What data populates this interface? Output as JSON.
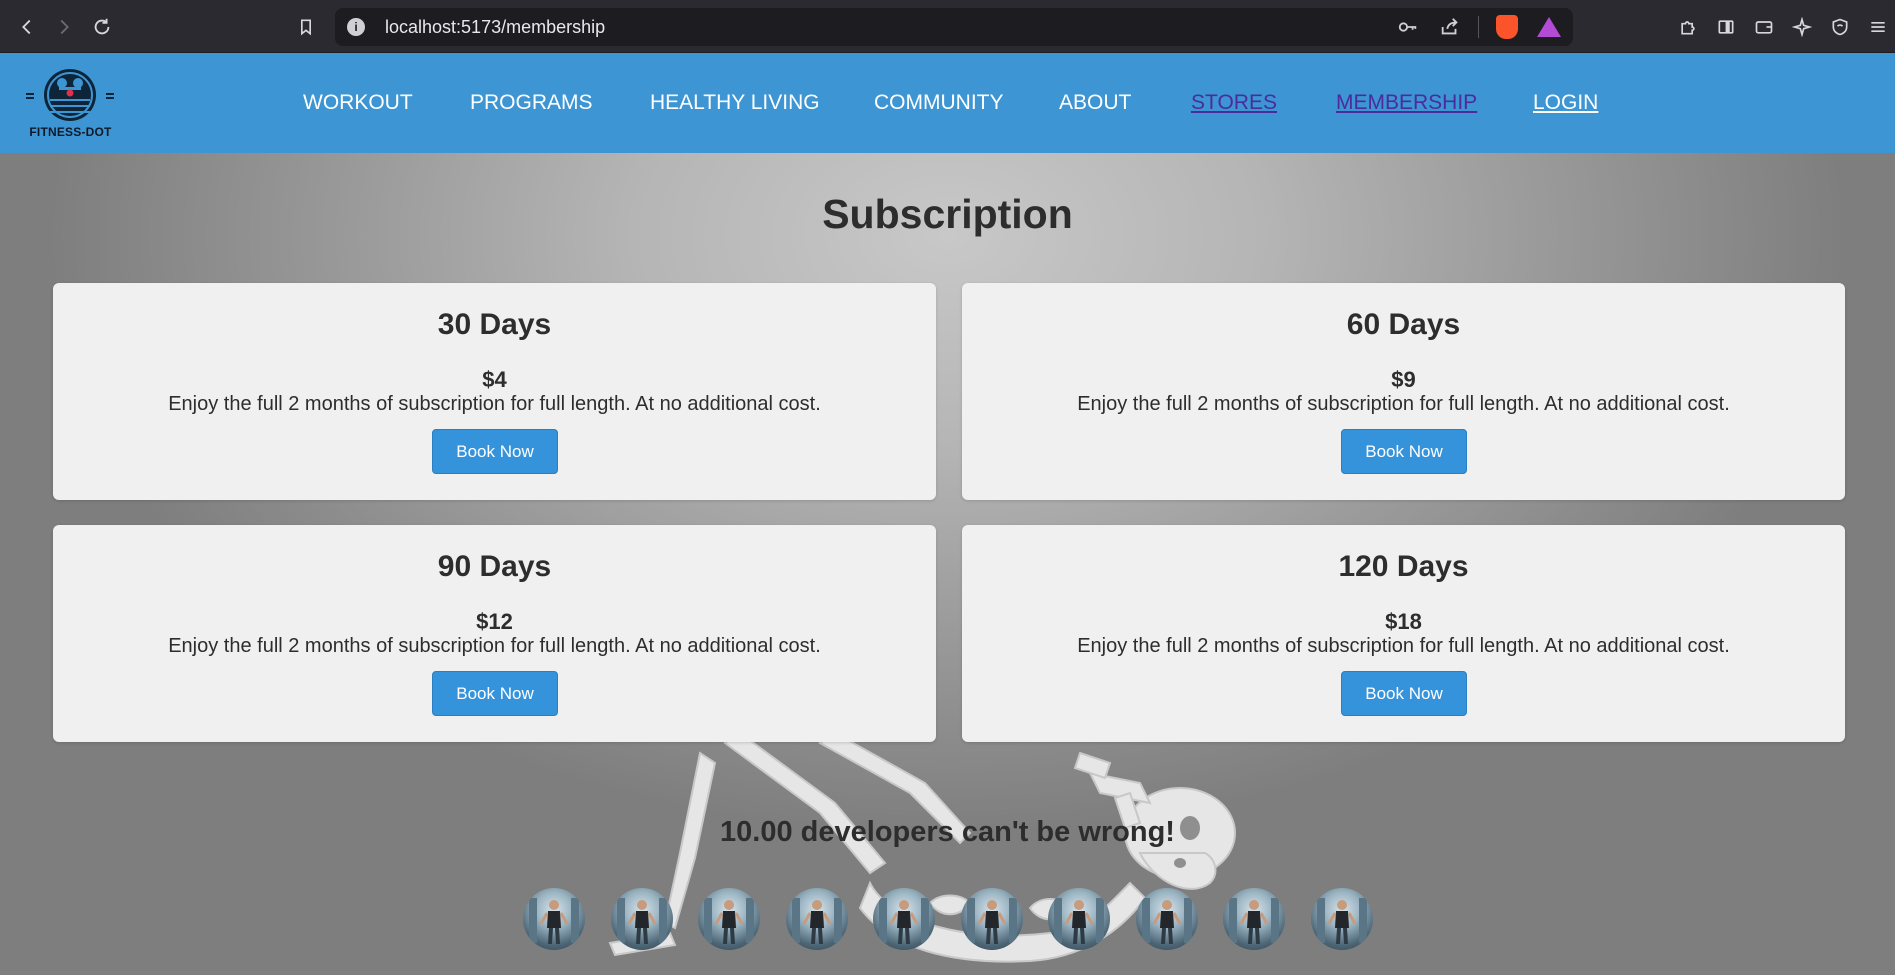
{
  "browser": {
    "url": "localhost:5173/membership",
    "icons": [
      "back-icon",
      "forward-icon",
      "reload-icon",
      "bookmark-icon",
      "site-info-icon",
      "key-icon",
      "share-icon",
      "brave-shields-icon",
      "brave-rewards-icon",
      "extensions-icon",
      "sidebar-icon",
      "wallet-icon",
      "leo-ai-icon",
      "vpn-icon",
      "menu-icon"
    ]
  },
  "header": {
    "logo_text": "FITNESS-DOT",
    "nav": [
      {
        "label": "WORKOUT"
      },
      {
        "label": "PROGRAMS"
      },
      {
        "label": "HEALTHY LIVING"
      },
      {
        "label": "COMMUNITY"
      },
      {
        "label": "ABOUT"
      },
      {
        "label": "STORES"
      },
      {
        "label": "MEMBERSHIP"
      },
      {
        "label": "LOGIN"
      }
    ],
    "colors": {
      "background": "#3d95d3",
      "link": "#ffffff",
      "visited_link": "#4b2c9e"
    }
  },
  "main": {
    "title": "Subscription",
    "plans": [
      {
        "duration": "30 Days",
        "price": "$4",
        "description": "Enjoy the full 2 months of subscription for full length. At no additional cost.",
        "button": "Book Now"
      },
      {
        "duration": "60 Days",
        "price": "$9",
        "description": "Enjoy the full 2 months of subscription for full length. At no additional cost.",
        "button": "Book Now"
      },
      {
        "duration": "90 Days",
        "price": "$12",
        "description": "Enjoy the full 2 months of subscription for full length. At no additional cost.",
        "button": "Book Now"
      },
      {
        "duration": "120 Days",
        "price": "$18",
        "description": "Enjoy the full 2 months of subscription for full length. At no additional cost.",
        "button": "Book Now"
      }
    ],
    "developers_heading": "10.00 developers can't be wrong!",
    "developer_avatar_count": 10,
    "colors": {
      "button": "#3593db",
      "card": "#f0f0f0",
      "text": "#2d2d2d"
    }
  }
}
